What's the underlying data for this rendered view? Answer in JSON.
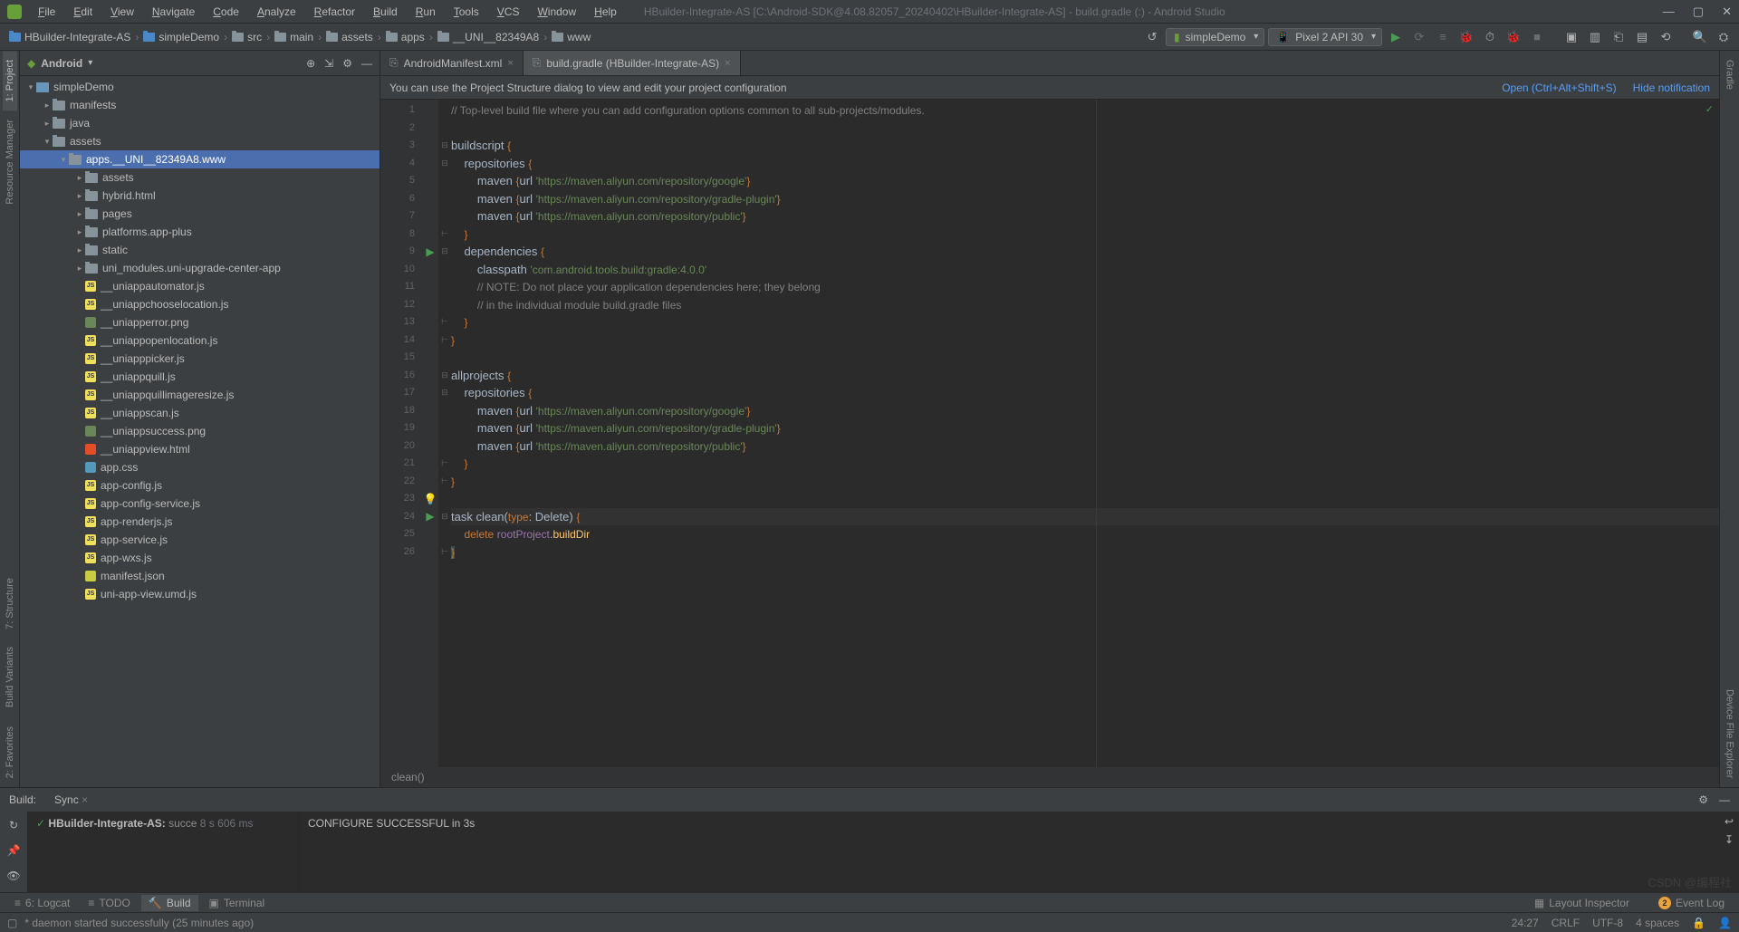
{
  "menus": [
    "File",
    "Edit",
    "View",
    "Navigate",
    "Code",
    "Analyze",
    "Refactor",
    "Build",
    "Run",
    "Tools",
    "VCS",
    "Window",
    "Help"
  ],
  "title": "HBuilder-Integrate-AS [C:\\Android-SDK@4.08.82057_20240402\\HBuilder-Integrate-AS] - build.gradle (:) - Android Studio",
  "breadcrumbs": [
    "HBuilder-Integrate-AS",
    "simpleDemo",
    "src",
    "main",
    "assets",
    "apps",
    "__UNI__82349A8",
    "www"
  ],
  "run_config": "simpleDemo",
  "device_config": "Pixel 2 API 30",
  "panel_title": "Android",
  "tree": {
    "root": "simpleDemo",
    "manifests": "manifests",
    "java": "java",
    "assets": "assets",
    "apps_www": "apps.__UNI__82349A8.www",
    "assets2": "assets",
    "hybrid": "hybrid.html",
    "pages": "pages",
    "platforms": "platforms.app-plus",
    "static": "static",
    "uni_modules": "uni_modules.uni-upgrade-center-app",
    "files": [
      "__uniappautomator.js",
      "__uniappchooselocation.js",
      "__uniapperror.png",
      "__uniappopenlocation.js",
      "__uniapppicker.js",
      "__uniappquill.js",
      "__uniappquillimageresize.js",
      "__uniappscan.js",
      "__uniappsuccess.png",
      "__uniappview.html",
      "app.css",
      "app-config.js",
      "app-config-service.js",
      "app-renderjs.js",
      "app-service.js",
      "app-wxs.js",
      "manifest.json",
      "uni-app-view.umd.js"
    ],
    "file_types": [
      "js",
      "js",
      "png",
      "js",
      "js",
      "js",
      "js",
      "js",
      "png",
      "html",
      "css",
      "js",
      "js",
      "js",
      "js",
      "js",
      "json",
      "js"
    ]
  },
  "tabs": [
    {
      "label": "AndroidManifest.xml",
      "active": false
    },
    {
      "label": "build.gradle (HBuilder-Integrate-AS)",
      "active": true
    }
  ],
  "notif": {
    "text": "You can use the Project Structure dialog to view and edit your project configuration",
    "open": "Open (Ctrl+Alt+Shift+S)",
    "hide": "Hide notification"
  },
  "code_lines": [
    {
      "n": 1,
      "html": "<span class='c-comment'>// Top-level build file where you can add configuration options common to all sub-projects/modules.</span>"
    },
    {
      "n": 2,
      "html": ""
    },
    {
      "n": 3,
      "html": "buildscript <span class='c-key'>{</span>",
      "fold": "⊟"
    },
    {
      "n": 4,
      "html": "    repositories <span class='c-key'>{</span>",
      "fold": "⊟"
    },
    {
      "n": 5,
      "html": "        maven <span class='c-key'>{</span>url <span class='c-str'>'https://maven.aliyun.com/repository/google'</span><span class='c-key'>}</span>"
    },
    {
      "n": 6,
      "html": "        maven <span class='c-key'>{</span>url <span class='c-str'>'https://maven.aliyun.com/repository/gradle-plugin'</span><span class='c-key'>}</span>"
    },
    {
      "n": 7,
      "html": "        maven <span class='c-key'>{</span>url <span class='c-str'>'https://maven.aliyun.com/repository/public'</span><span class='c-key'>}</span>"
    },
    {
      "n": 8,
      "html": "    <span class='c-key'>}</span>",
      "fold": "⊢"
    },
    {
      "n": 9,
      "html": "    dependencies <span class='c-key'>{</span>",
      "fold": "⊟",
      "run": true
    },
    {
      "n": 10,
      "html": "        classpath <span class='c-str'>'com.android.tools.build:gradle:4.0.0'</span>"
    },
    {
      "n": 11,
      "html": "        <span class='c-comment'>// NOTE: Do not place your application dependencies here; they belong</span>"
    },
    {
      "n": 12,
      "html": "        <span class='c-comment'>// in the individual module build.gradle files</span>"
    },
    {
      "n": 13,
      "html": "    <span class='c-key'>}</span>",
      "fold": "⊢"
    },
    {
      "n": 14,
      "html": "<span class='c-key'>}</span>",
      "fold": "⊢"
    },
    {
      "n": 15,
      "html": ""
    },
    {
      "n": 16,
      "html": "allprojects <span class='c-key'>{</span>",
      "fold": "⊟"
    },
    {
      "n": 17,
      "html": "    repositories <span class='c-key'>{</span>",
      "fold": "⊟"
    },
    {
      "n": 18,
      "html": "        maven <span class='c-key'>{</span>url <span class='c-str'>'https://maven.aliyun.com/repository/google'</span><span class='c-key'>}</span>"
    },
    {
      "n": 19,
      "html": "        maven <span class='c-key'>{</span>url <span class='c-str'>'https://maven.aliyun.com/repository/gradle-plugin'</span><span class='c-key'>}</span>"
    },
    {
      "n": 20,
      "html": "        maven <span class='c-key'>{</span>url <span class='c-str'>'https://maven.aliyun.com/repository/public'</span><span class='c-key'>}</span>"
    },
    {
      "n": 21,
      "html": "    <span class='c-key'>}</span>",
      "fold": "⊢"
    },
    {
      "n": 22,
      "html": "<span class='c-key'>}</span>",
      "fold": "⊢"
    },
    {
      "n": 23,
      "html": "",
      "bulb": true
    },
    {
      "n": 24,
      "html": "task clean(<span class='c-type'>type</span>: Delete) <span class='c-key'>{</span>",
      "fold": "⊟",
      "run": true,
      "cur": true
    },
    {
      "n": 25,
      "html": "    <span class='c-key'>delete</span> <span class='c-ident'>rootProject</span>.<span class='c-warn'>buildDir</span>"
    },
    {
      "n": 26,
      "html": "<span class='c-key' style='background:#3b514d'>}</span>",
      "fold": "⊢"
    }
  ],
  "editor_breadcrumb": "clean()",
  "build": {
    "label": "Build:",
    "sync_tab": "Sync",
    "proj_name": "HBuilder-Integrate-AS:",
    "proj_status": "succe",
    "proj_time": "8 s 606 ms",
    "output": "CONFIGURE SUCCESSFUL in 3s"
  },
  "status_tabs": {
    "logcat": "6: Logcat",
    "todo": "TODO",
    "build": "Build",
    "terminal": "Terminal",
    "inspector": "Layout Inspector",
    "eventlog": "Event Log"
  },
  "statusbar": {
    "msg": "* daemon started successfully (25 minutes ago)",
    "pos": "24:27",
    "crlf": "CRLF",
    "enc": "UTF-8",
    "indent": "4 spaces"
  },
  "left_labels": [
    "1: Project",
    "Resource Manager"
  ],
  "left_labels2": [
    "7: Structure",
    "Build Variants",
    "2: Favorites"
  ],
  "right_labels": [
    "Gradle",
    "Device File Explorer"
  ],
  "watermark": "CSDN @编程社"
}
